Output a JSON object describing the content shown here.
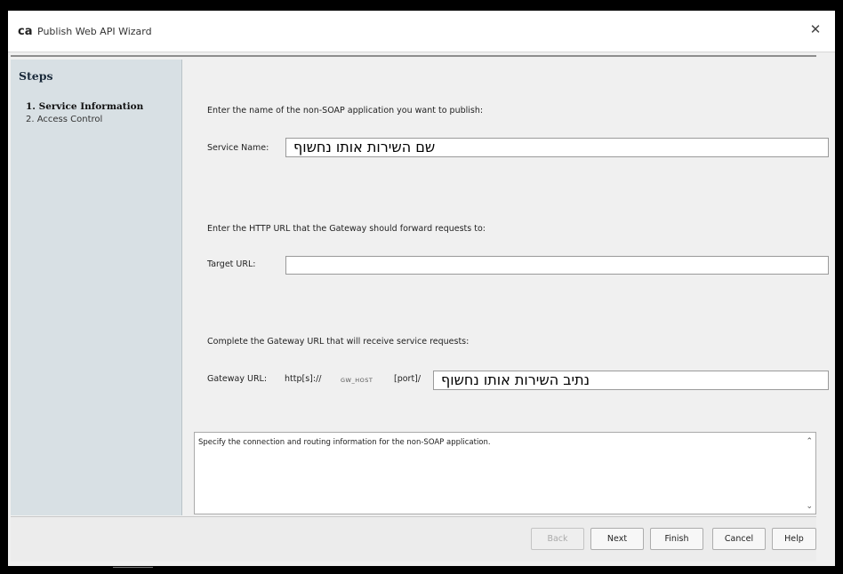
{
  "window": {
    "logo": "ca",
    "title": "Publish Web API Wizard",
    "close_glyph": "✕"
  },
  "steps": {
    "heading": "Steps",
    "items": [
      {
        "label": "1. Service Information",
        "active": true
      },
      {
        "label": "2. Access Control",
        "active": false
      }
    ]
  },
  "form": {
    "service_prompt": "Enter the name of the non-SOAP application you want to publish:",
    "service_name_label": "Service Name:",
    "service_name_value": "שם השירות אותו נחשוף",
    "target_prompt": "Enter the HTTP URL that the Gateway should forward requests to:",
    "target_url_label": "Target URL:",
    "target_url_value": "",
    "gateway_prompt": "Complete the Gateway URL that will receive service requests:",
    "gateway_url_label": "Gateway URL:",
    "gateway_prefix": "http[s]://",
    "gateway_host": "GW_HOST",
    "gateway_port": "[port]/",
    "gateway_url_value": "נתיב השירות אותו נחשוף"
  },
  "description": {
    "text": "Specify the connection and routing information for the non-SOAP application."
  },
  "buttons": {
    "back": "Back",
    "next": "Next",
    "finish": "Finish",
    "cancel": "Cancel",
    "help": "Help"
  },
  "icons": {
    "close": "close-icon",
    "scroll_up": "chevron-up-icon",
    "scroll_down": "chevron-down-icon"
  },
  "colors": {
    "steps_panel": "#d8e0e4",
    "border": "#000000"
  }
}
